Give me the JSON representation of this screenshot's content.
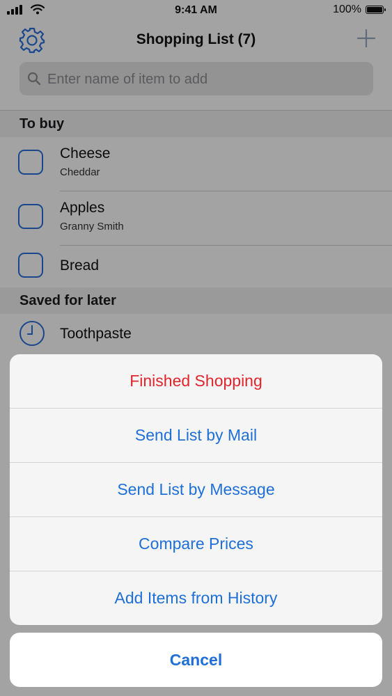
{
  "status": {
    "time": "9:41 AM",
    "battery": "100%",
    "battery_level": 1.0
  },
  "nav": {
    "title": "Shopping List (7)"
  },
  "search": {
    "placeholder": "Enter name of item to add"
  },
  "sections": {
    "to_buy": {
      "title": "To buy",
      "items": [
        {
          "name": "Cheese",
          "detail": "Cheddar"
        },
        {
          "name": "Apples",
          "detail": "Granny Smith"
        },
        {
          "name": "Bread",
          "detail": ""
        }
      ]
    },
    "saved": {
      "title": "Saved for later",
      "items": [
        {
          "name": "Toothpaste"
        }
      ]
    }
  },
  "action_sheet": {
    "actions": [
      {
        "label": "Finished Shopping",
        "style": "destructive"
      },
      {
        "label": "Send List by Mail",
        "style": "default"
      },
      {
        "label": "Send List by Message",
        "style": "default"
      },
      {
        "label": "Compare Prices",
        "style": "default"
      },
      {
        "label": "Add Items from History",
        "style": "default"
      }
    ],
    "cancel_label": "Cancel"
  },
  "colors": {
    "accent": "#1f6fd9",
    "destructive": "#e0262c",
    "checkbox": "#2a6fdb"
  },
  "icons": {
    "settings": "gear-icon",
    "add": "plus-icon",
    "search": "search-icon",
    "saved_item": "clock-icon",
    "wifi": "wifi-icon",
    "signal": "signal-icon",
    "battery": "battery-icon"
  }
}
